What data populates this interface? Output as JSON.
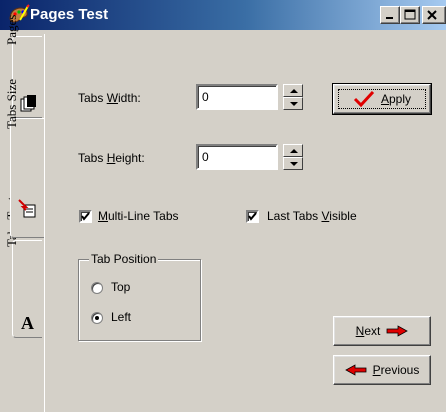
{
  "window": {
    "title": "Pages Test"
  },
  "tabs": [
    {
      "label": "Pages",
      "active": false
    },
    {
      "label": "Tabs Size",
      "active": true
    },
    {
      "label": "Tabs Text",
      "active": false
    }
  ],
  "form": {
    "tabs_width": {
      "label_pre": "Tabs ",
      "label_mn": "W",
      "label_post": "idth:",
      "value": "0"
    },
    "tabs_height": {
      "label_pre": "Tabs ",
      "label_mn": "H",
      "label_post": "eight:",
      "value": "0"
    },
    "apply_button": {
      "label_mn": "A",
      "label_post": "pply"
    },
    "multiline_tabs": {
      "label_mn": "M",
      "label_post": "ulti-Line Tabs",
      "checked": true
    },
    "last_tabs_visible": {
      "label_pre": "Last Tabs ",
      "label_mn": "V",
      "label_post": "isible",
      "checked": true
    },
    "tab_position": {
      "title": "Tab Position",
      "options": [
        {
          "label": "Top",
          "selected": false
        },
        {
          "label": "Left",
          "selected": true
        }
      ]
    },
    "next_button": {
      "label_mn": "N",
      "label_post": "ext"
    },
    "previous_button": {
      "label_mn": "P",
      "label_post": "revious"
    }
  },
  "colors": {
    "accent_red": "#e00000",
    "window_bg": "#d4d0c8"
  },
  "icons": {
    "title": "paint-palette-icon",
    "pages_tab": "pages-icon",
    "tabs_size_tab": "resize-page-icon",
    "tabs_text_tab": "font-a-icon",
    "apply": "checkmark-icon",
    "next": "right-arrow-icon",
    "previous": "left-arrow-icon"
  }
}
